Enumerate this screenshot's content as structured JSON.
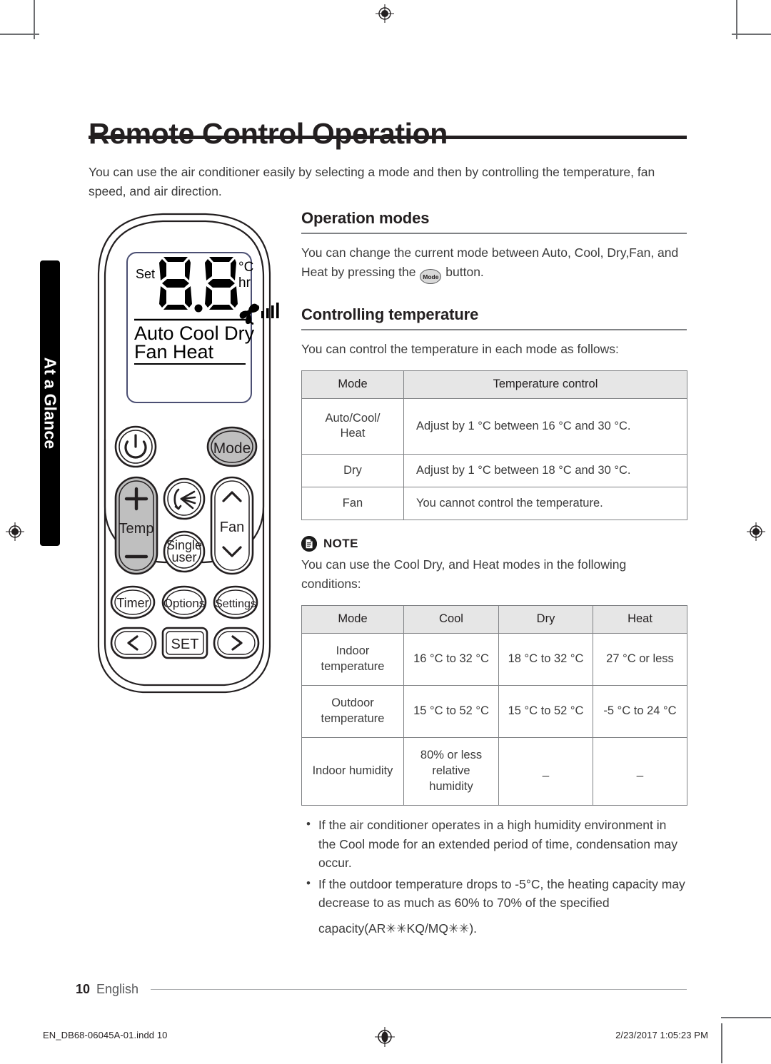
{
  "sidebar": {
    "tab_label": "At a Glance"
  },
  "header": {
    "title": "Remote Control Operation",
    "intro": "You can use the air conditioner easily by selecting a mode and then by controlling the temperature, fan speed, and air direction."
  },
  "operation_modes": {
    "heading": "Operation modes",
    "text_before": "You can change the current mode between Auto, Cool, Dry,Fan, and Heat by pressing the",
    "inline_button_label": "Mode",
    "text_after": "button."
  },
  "controlling_temperature": {
    "heading": "Controlling temperature",
    "intro": "You can control the temperature in each mode as follows:",
    "table": {
      "headers": [
        "Mode",
        "Temperature control"
      ],
      "rows": [
        [
          "Auto/Cool/\nHeat",
          "Adjust by 1 °C between 16 °C and 30 °C."
        ],
        [
          "Dry",
          "Adjust by 1 °C between 18 °C and 30 °C."
        ],
        [
          "Fan",
          "You cannot control the temperature."
        ]
      ]
    }
  },
  "note": {
    "icon": "document-icon",
    "title": "NOTE",
    "intro": "You can use the Cool Dry, and Heat  modes in the following conditions:",
    "table": {
      "headers": [
        "Mode",
        "Cool",
        "Dry",
        "Heat"
      ],
      "rows": [
        [
          "Indoor\ntemperature",
          "16 °C to 32 °C",
          "18 °C to 32 °C",
          "27 °C or less"
        ],
        [
          "Outdoor\ntemperature",
          "15 °C to 52 °C",
          "15 °C to 52 °C",
          "-5 °C to 24 °C"
        ],
        [
          "Indoor humidity",
          "80% or less\nrelative\nhumidity",
          "_",
          "_"
        ]
      ]
    },
    "bullets": [
      "If the air conditioner operates in a high humidity environment in the Cool mode for an extended period of time, condensation may occur.",
      "If the outdoor temperature drops to -5°C, the heating capacity may decrease to as much as 60% to 70% of the specified"
    ],
    "bullet_continuation": "capacity(AR✳✳KQ/MQ✳✳)."
  },
  "remote": {
    "display": {
      "set_label": "Set",
      "digits": "8.8",
      "unit_c": "°C",
      "unit_hr": "hr",
      "fan_icon": "fan-blade-icon",
      "fan_bars_icon": "fan-speed-bars-icon",
      "modes_line1": "Auto Cool Dry",
      "modes_line2": "Fan   Heat"
    },
    "buttons": {
      "power": "power-icon",
      "mode": "Mode",
      "temp": "Temp",
      "temp_plus": "+",
      "temp_minus": "−",
      "airflow": "airflow-icon",
      "single_user_l1": "Single",
      "single_user_l2": "user",
      "fan": "Fan",
      "fan_up": "chevron-up-icon",
      "fan_down": "chevron-down-icon",
      "timer": "Timer",
      "options": "Options",
      "settings": "Settings",
      "prev": "‹",
      "set": "SET",
      "next": "›"
    }
  },
  "footer": {
    "page_number": "10",
    "language": "English",
    "print_filename": "EN_DB68-06045A-01.indd   10",
    "print_timestamp": "2/23/2017   1:05:23 PM"
  }
}
